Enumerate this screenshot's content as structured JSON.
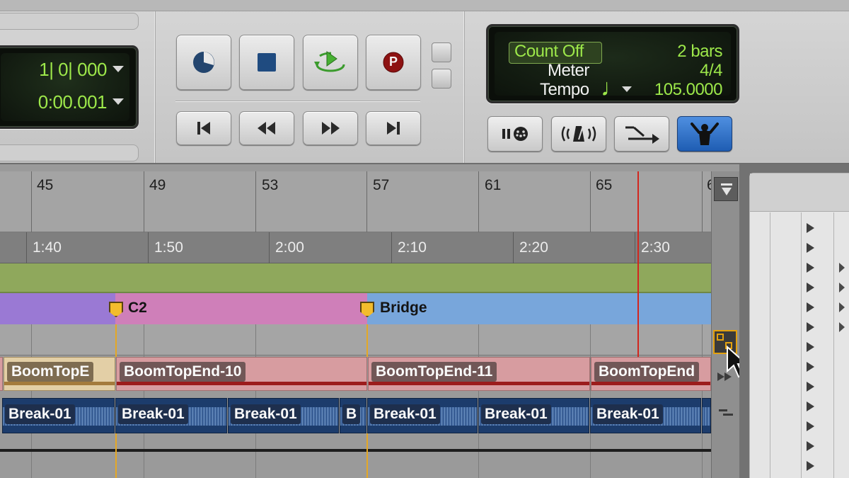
{
  "counter": {
    "bars_beats": "1| 0| 000",
    "min_sec": "0:00.001"
  },
  "midi_display": {
    "count_off_label": "Count Off",
    "count_off_value": "2 bars",
    "meter_label": "Meter",
    "meter_value": "4/4",
    "tempo_label": "Tempo",
    "tempo_value": "105.0000",
    "note_symbol": "♩"
  },
  "transport": {
    "online_icon": "clock-pie-icon",
    "stop_icon": "stop-icon",
    "play_icon": "loop-play-icon",
    "record_icon": "record-icon",
    "record_letter": "P",
    "rtz_icon": "return-to-zero-icon",
    "rewind_icon": "rewind-icon",
    "ffwd_icon": "fast-forward-icon",
    "eos_icon": "go-to-end-icon"
  },
  "midi_buttons": {
    "wait_note_text": "II",
    "metronome_text": "((·))",
    "merge_icon": "merge-arrow-icon",
    "conductor_icon": "conductor-icon"
  },
  "rulers": {
    "bars": [
      "45",
      "49",
      "53",
      "57",
      "61",
      "65",
      "6"
    ],
    "minsecs": [
      "1:40",
      "1:50",
      "2:00",
      "2:10",
      "2:20",
      "2:30"
    ]
  },
  "markers": [
    {
      "label": "C2"
    },
    {
      "label": "Bridge"
    }
  ],
  "track1_clips": [
    "BoomTopE",
    "BoomTopEnd-10",
    "BoomTopEnd-11",
    "BoomTopEnd"
  ],
  "track2_clips": [
    "Break-01",
    "Break-01",
    "Break-01",
    "B",
    "Break-01",
    "Break-01",
    "Break-01",
    ""
  ],
  "colors": {
    "lcd_green": "#9de84a",
    "tempo_ruler": "#8fa85c",
    "marker_purple": "#9a79d4",
    "marker_pink": "#cf7fb9",
    "marker_blue": "#78a6db",
    "clip_red": "#d79ca0",
    "clip_tan": "#e3cfa6",
    "audio_blue": "#1c3c6c",
    "playhead": "#d2261e",
    "conductor_active": "#2a6cc7"
  }
}
